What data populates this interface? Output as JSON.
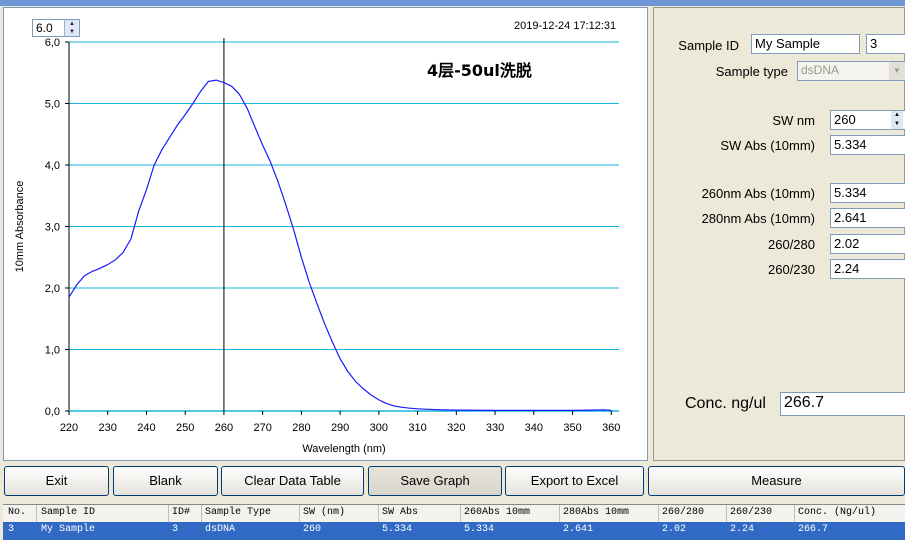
{
  "chart_panel": {
    "spin_value": "6.0",
    "timestamp": "2019-12-24 17:12:31"
  },
  "chart_data": {
    "type": "line",
    "annotation": "4层-50ul洗脱",
    "xlabel": "Wavelength (nm)",
    "ylabel": "10mm Absorbance",
    "xlim": [
      220,
      362
    ],
    "ylim": [
      0,
      6
    ],
    "x_ticks": [
      "220",
      "230",
      "240",
      "250",
      "260",
      "270",
      "280",
      "290",
      "300",
      "310",
      "320",
      "330",
      "340",
      "350",
      "360"
    ],
    "y_ticks": [
      "0,0",
      "1,0",
      "2,0",
      "3,0",
      "4,0",
      "5,0",
      "6,0"
    ],
    "grid": "horizontal",
    "marker_x": 260,
    "series_color": "#1a1aff",
    "series": [
      {
        "x": [
          220,
          222,
          224,
          226,
          228,
          230,
          232,
          234,
          236,
          238,
          240,
          242,
          244,
          246,
          248,
          250,
          252,
          254,
          256,
          258,
          260,
          262,
          264,
          266,
          268,
          270,
          272,
          274,
          276,
          278,
          280,
          282,
          284,
          286,
          288,
          290,
          292,
          294,
          296,
          298,
          300,
          302,
          304,
          306,
          308,
          310,
          312,
          316,
          320,
          330,
          340,
          350,
          355,
          358,
          360
        ],
        "y": [
          1.85,
          2.05,
          2.2,
          2.27,
          2.32,
          2.38,
          2.46,
          2.58,
          2.8,
          3.25,
          3.6,
          4.0,
          4.25,
          4.45,
          4.65,
          4.82,
          5.0,
          5.2,
          5.36,
          5.38,
          5.34,
          5.28,
          5.15,
          4.92,
          4.62,
          4.32,
          4.05,
          3.72,
          3.35,
          2.95,
          2.5,
          2.1,
          1.75,
          1.42,
          1.12,
          0.85,
          0.64,
          0.48,
          0.36,
          0.26,
          0.18,
          0.12,
          0.08,
          0.06,
          0.045,
          0.035,
          0.03,
          0.02,
          0.015,
          0.01,
          0.01,
          0.01,
          0.015,
          0.02,
          0.01
        ]
      }
    ]
  },
  "right_panel": {
    "sample_id_label": "Sample ID",
    "sample_id_value": "My Sample",
    "id_number": "3",
    "sample_type_label": "Sample type",
    "sample_type_value": "dsDNA",
    "sw_nm_label": "SW nm",
    "sw_nm_value": "260",
    "sw_abs_label": "SW Abs (10mm)",
    "sw_abs_value": "5.334",
    "abs260_label": "260nm Abs (10mm)",
    "abs260_value": "5.334",
    "abs280_label": "280nm Abs (10mm)",
    "abs280_value": "2.641",
    "r260_280_label": "260/280",
    "r260_280_value": "2.02",
    "r260_230_label": "260/230",
    "r260_230_value": "2.24",
    "conc_label": "Conc. ng/ul",
    "conc_value": "266.7"
  },
  "buttons": {
    "exit": "Exit",
    "blank": "Blank",
    "clear": "Clear Data Table",
    "save": "Save Graph",
    "export": "Export to Excel",
    "measure": "Measure"
  },
  "table": {
    "headers": [
      "No.",
      "Sample ID",
      "ID#",
      "Sample Type",
      "SW (nm)",
      "SW Abs",
      "260Abs 10mm",
      "280Abs 10mm",
      "260/280",
      "260/230",
      "Conc. (Ng/ul)"
    ],
    "row": [
      "3",
      "My Sample",
      "3",
      "dsDNA",
      "260",
      "5.334",
      "5.334",
      "2.641",
      "2.02",
      "2.24",
      "266.7"
    ]
  }
}
